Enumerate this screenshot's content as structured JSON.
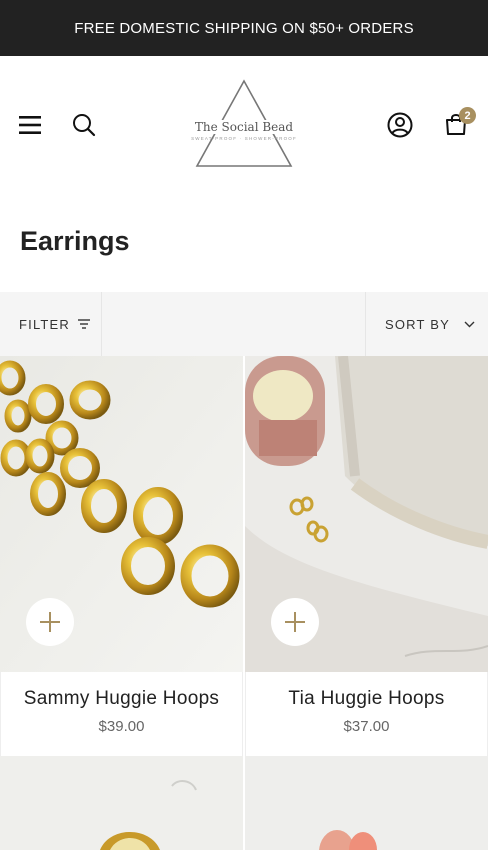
{
  "announcement": "FREE DOMESTIC SHIPPING ON $50+ ORDERS",
  "header": {
    "logo_name": "The Social Bead",
    "logo_tagline": "SWEAT-PROOF · SHOWER-PROOF",
    "cart_count": "2"
  },
  "collection": {
    "title": "Earrings"
  },
  "toolbar": {
    "filter_label": "FILTER",
    "sort_label": "SORT BY"
  },
  "products": [
    {
      "name": "Sammy Huggie Hoops",
      "price": "$39.00"
    },
    {
      "name": "Tia Huggie Hoops",
      "price": "$37.00"
    }
  ],
  "colors": {
    "announcement_bg": "#222222",
    "accent": "#a89060",
    "toolbar_bg": "#f5f5f5"
  }
}
